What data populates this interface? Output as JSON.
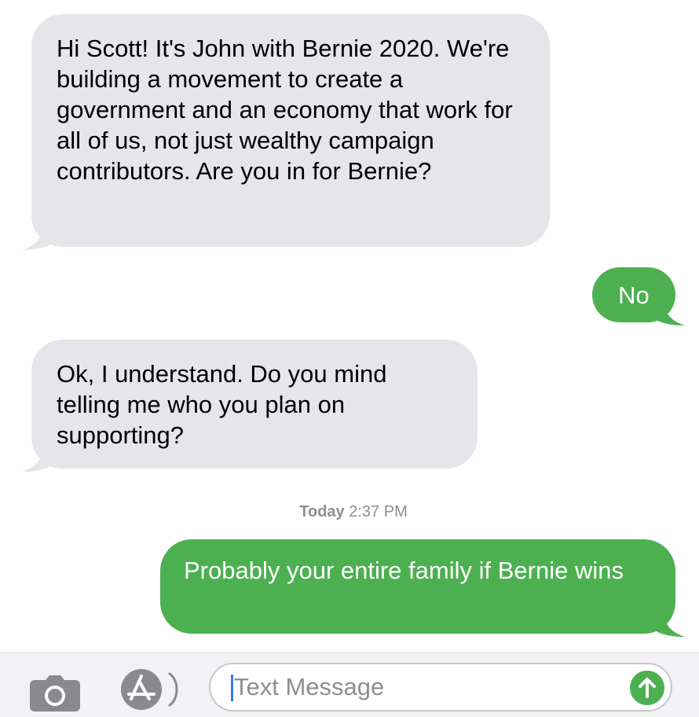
{
  "colors": {
    "incoming_bubble": "#e5e5ea",
    "outgoing_bubble": "#4cb050",
    "timestamp_text": "#8e8e93"
  },
  "messages": [
    {
      "direction": "incoming",
      "text": "Hi Scott! It's John with Bernie 2020. We're building a movement to create a government and an economy that work for all of us, not just wealthy campaign contributors. Are you in for Bernie?"
    },
    {
      "direction": "outgoing",
      "text": "No"
    },
    {
      "direction": "incoming",
      "text": "Ok, I understand. Do you mind telling me who you plan on supporting?"
    },
    {
      "direction": "outgoing",
      "text": "Probably your entire family if Bernie wins"
    }
  ],
  "timestamp": {
    "day": "Today",
    "time": "2:37 PM"
  },
  "composer": {
    "placeholder": "Text Message",
    "camera_icon": "camera-icon",
    "apps_icon": "app-store-icon",
    "send_icon": "arrow-up-icon"
  }
}
